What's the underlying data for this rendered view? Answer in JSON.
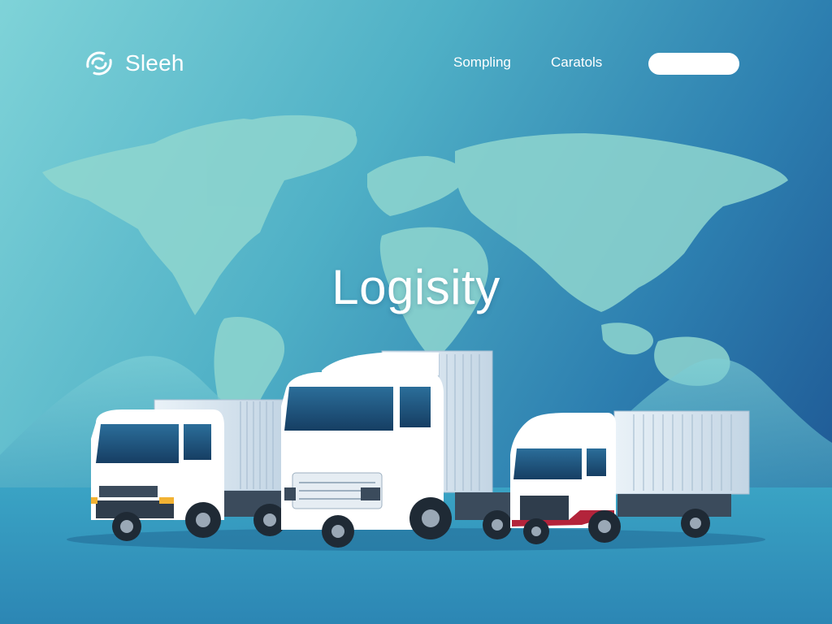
{
  "header": {
    "brand": "Sleeh",
    "nav": [
      {
        "label": "Sompling"
      },
      {
        "label": "Caratols"
      }
    ],
    "cta_label": ""
  },
  "hero": {
    "title": "Logisity"
  },
  "icons": {
    "logo": "swirl-logo-icon"
  },
  "colors": {
    "bg_light": "#7fd3d8",
    "bg_mid": "#2d7fb0",
    "bg_dark": "#1b4f8e",
    "map": "#8fd6cf",
    "truck_white": "#ffffff",
    "trailer_grey": "#d7e4ee",
    "accent_red": "#b3243b"
  }
}
